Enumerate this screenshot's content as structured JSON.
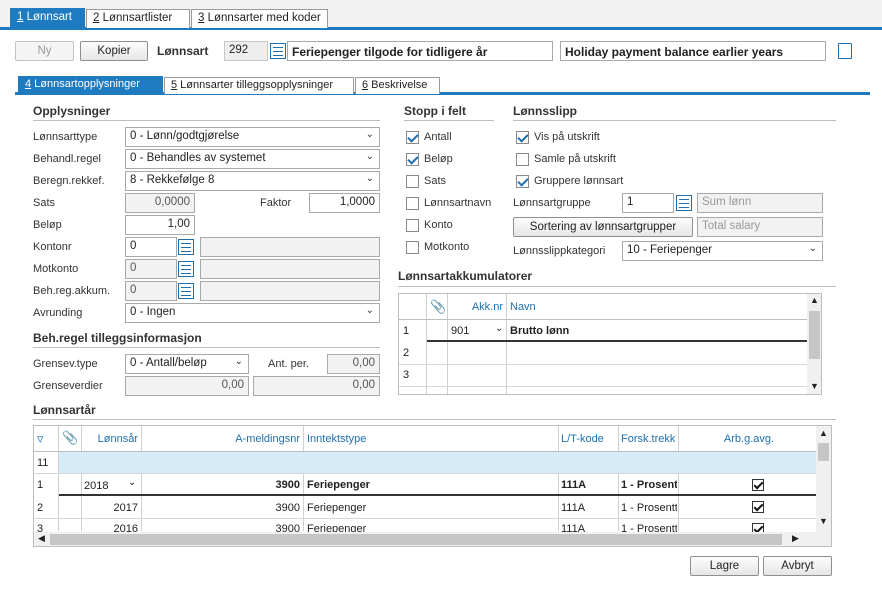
{
  "main_tabs": [
    {
      "key": "1",
      "label": " Lønnsart"
    },
    {
      "key": "2",
      "label": " Lønnsartlister"
    },
    {
      "key": "3",
      "label": " Lønnsarter med koder"
    }
  ],
  "toolbar": {
    "new_label": "Ny",
    "copy_label": "Kopier",
    "lonnsart_label": "Lønnsart",
    "lonnsart_no": "292",
    "name_no": "Feriepenger tilgode for tidligere år",
    "name_en": "Holiday payment balance earlier years"
  },
  "sub_tabs": [
    {
      "key": "4",
      "label": " Lønnsartopplysninger"
    },
    {
      "key": "5",
      "label": " Lønnsarter tilleggsopplysninger"
    },
    {
      "key": "6",
      "label": " Beskrivelse"
    }
  ],
  "opplysninger": {
    "title": "Opplysninger",
    "lonnsarttype_label": "Lønnsarttype",
    "lonnsarttype_value": "0 - Lønn/godtgjørelse",
    "behandl_label": "Behandl.regel",
    "behandl_value": "0 - Behandles av systemet",
    "beregn_label": "Beregn.rekkef.",
    "beregn_value": "8 - Rekkefølge 8",
    "sats_label": "Sats",
    "sats_value": "0,0000",
    "faktor_label": "Faktor",
    "faktor_value": "1,0000",
    "belop_label": "Beløp",
    "belop_value": "1,00",
    "kontonr_label": "Kontonr",
    "kontonr_value": "0",
    "motkonto_label": "Motkonto",
    "motkonto_value": "0",
    "behreg_label": "Beh.reg.akkum.",
    "behreg_value": "0",
    "avrunding_label": "Avrunding",
    "avrunding_value": "0 - Ingen"
  },
  "tillegg": {
    "title": "Beh.regel tilleggsinformasjon",
    "grensev_type_label": "Grensev.type",
    "grensev_type_value": "0 - Antall/beløp",
    "antper_label": "Ant. per.",
    "antper_value": "0,00",
    "grenseverdier_label": "Grenseverdier",
    "grenseverdi1": "0,00",
    "grenseverdi2": "0,00"
  },
  "stopp": {
    "title": "Stopp i felt",
    "items": [
      {
        "label": "Antall",
        "checked": true
      },
      {
        "label": "Beløp",
        "checked": true
      },
      {
        "label": "Sats",
        "checked": false
      },
      {
        "label": "Lønnsartnavn",
        "checked": false
      },
      {
        "label": "Konto",
        "checked": false
      },
      {
        "label": "Motkonto",
        "checked": false
      }
    ]
  },
  "lonnsslipp": {
    "title": "Lønnsslipp",
    "items": [
      {
        "label": "Vis på utskrift",
        "checked": true
      },
      {
        "label": "Samle på utskrift",
        "checked": false
      },
      {
        "label": "Gruppere lønnsart",
        "checked": true
      }
    ],
    "gruppe_label": "Lønnsartgruppe",
    "gruppe_value": "1",
    "gruppe_name": "Sum lønn",
    "sort_button": "Sortering av lønnsartgrupper",
    "sort_name": "Total salary",
    "kategori_label": "Lønnsslippkategori",
    "kategori_value": "10 - Feriepenger"
  },
  "akkumulatorer": {
    "title": "Lønnsartakkumulatorer",
    "col_akknr": "Akk.nr",
    "col_navn": "Navn",
    "rows": [
      {
        "n": "1",
        "akknr": "901",
        "navn": "Brutto lønn"
      },
      {
        "n": "2",
        "akknr": "",
        "navn": ""
      },
      {
        "n": "3",
        "akknr": "",
        "navn": ""
      }
    ]
  },
  "lonnsartar": {
    "title": "Lønnsartår",
    "columns": [
      "Lønnsår",
      "A-meldingsnr",
      "Inntektstype",
      "L/T-kode",
      "Forsk.trekk",
      "Arb.g.avg."
    ],
    "new_row_no": "11",
    "rows": [
      {
        "n": "1",
        "year": "2018",
        "amelding": "3900",
        "inntekt": "Feriepenger",
        "lt": "111A",
        "forsk": "1 - Prosent",
        "arb": true
      },
      {
        "n": "2",
        "year": "2017",
        "amelding": "3900",
        "inntekt": "Feriepenger",
        "lt": "111A",
        "forsk": "1 - Prosentt",
        "arb": true
      },
      {
        "n": "3",
        "year": "2016",
        "amelding": "3900",
        "inntekt": "Feriepenger",
        "lt": "111A",
        "forsk": "1 - Prosentt",
        "arb": true
      }
    ]
  },
  "footer": {
    "save": "Lagre",
    "cancel": "Avbryt"
  },
  "colors": {
    "accent": "#1f7bc0",
    "row_highlight": "#d6ebf8"
  }
}
